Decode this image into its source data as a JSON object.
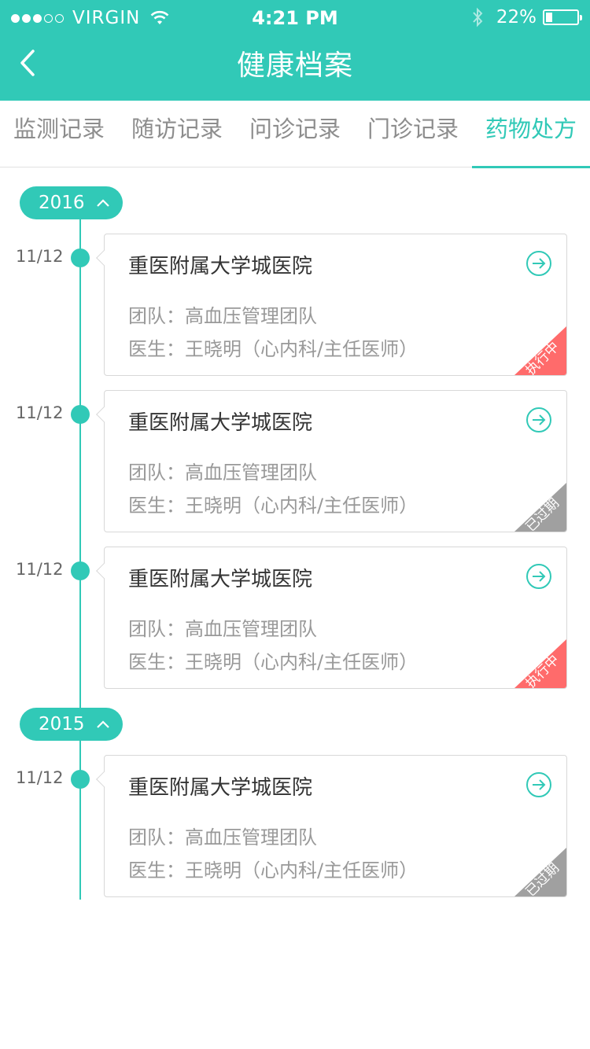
{
  "status_bar": {
    "carrier": "VIRGIN",
    "time": "4:21 PM",
    "battery_percent": "22%",
    "signal_strength": 3
  },
  "nav": {
    "title": "健康档案",
    "back_icon": "chevron-left-icon"
  },
  "tabs": [
    {
      "label": "监测记录",
      "active": false
    },
    {
      "label": "随访记录",
      "active": false
    },
    {
      "label": "问诊记录",
      "active": false
    },
    {
      "label": "门诊记录",
      "active": false
    },
    {
      "label": "药物处方",
      "active": true
    }
  ],
  "years": [
    {
      "year": "2016",
      "entries": [
        {
          "date": "11/12",
          "hospital": "重医附属大学城医院",
          "team": "团队：高血压管理团队",
          "doctor": "医生：王晓明（心内科/主任医师）",
          "status": "执行中",
          "status_type": "active"
        },
        {
          "date": "11/12",
          "hospital": "重医附属大学城医院",
          "team": "团队：高血压管理团队",
          "doctor": "医生：王晓明（心内科/主任医师）",
          "status": "已过期",
          "status_type": "expired"
        },
        {
          "date": "11/12",
          "hospital": "重医附属大学城医院",
          "team": "团队：高血压管理团队",
          "doctor": "医生：王晓明（心内科/主任医师）",
          "status": "执行中",
          "status_type": "active"
        }
      ]
    },
    {
      "year": "2015",
      "entries": [
        {
          "date": "11/12",
          "hospital": "重医附属大学城医院",
          "team": "团队：高血压管理团队",
          "doctor": "医生：王晓明（心内科/主任医师）",
          "status": "已过期",
          "status_type": "expired"
        }
      ]
    }
  ],
  "colors": {
    "accent": "#31c9b7",
    "status_active": "#ff6b6b",
    "status_expired": "#a0a0a0"
  }
}
